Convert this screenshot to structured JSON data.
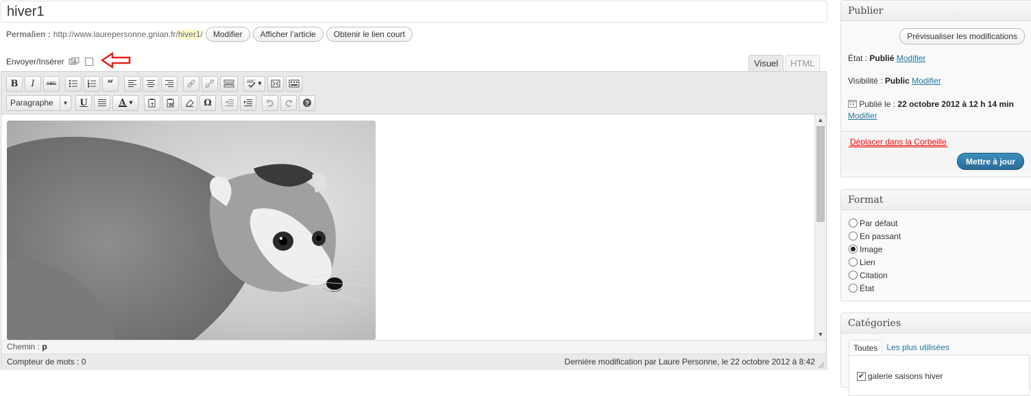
{
  "post": {
    "title": "hiver1",
    "permalink_label": "Permalien :",
    "permalink_base": "http://www.laurepersonne.gnian.fr/",
    "permalink_slug": "hiver1",
    "permalink_trailing": "/",
    "buttons": {
      "edit": "Modifier",
      "view": "Afficher l’article",
      "shortlink": "Obtenir le lien court"
    }
  },
  "media": {
    "label": "Envoyer/Insérer",
    "icon": "media-upload-icon"
  },
  "editor": {
    "tabs": [
      "Visuel",
      "HTML"
    ],
    "active_tab": "Visuel",
    "format_select": "Paragraphe",
    "image_alt": "lemur photograph (black and white)",
    "path_label": "Chemin :",
    "path_value": "p",
    "word_count": "Compteur de mots : 0",
    "last_modified": "Dernière modification par Laure Personne, le 22 octobre 2012 à 8:42",
    "toolbar_row1": [
      "bold",
      "italic",
      "strikethrough",
      "bullet-list",
      "numbered-list",
      "blockquote",
      "align-left",
      "align-center",
      "align-right",
      "link",
      "unlink",
      "more-tag",
      "spellcheck",
      "fullscreen",
      "kitchen-sink"
    ],
    "toolbar_row2": [
      "underline",
      "justify",
      "text-color",
      "paste-text",
      "paste-word",
      "clear-formatting",
      "special-character",
      "outdent",
      "indent",
      "undo",
      "redo",
      "help"
    ]
  },
  "publish": {
    "heading": "Publier",
    "preview_button": "Prévisualiser les modifications",
    "status_label": "État :",
    "status_value": "Publié",
    "visibility_label": "Visibilité :",
    "visibility_value": "Public",
    "edit_link": "Modifier",
    "published_label": "Publié le :",
    "published_value": "22 octobre 2012 à 12 h 14 min",
    "trash_link": "Déplacer dans la Corbeille",
    "update_button": "Mettre à jour"
  },
  "format": {
    "heading": "Format",
    "options": [
      "Par défaut",
      "En passant",
      "Image",
      "Lien",
      "Citation",
      "État"
    ],
    "selected": "Image"
  },
  "categories": {
    "heading": "Catégories",
    "tabs": [
      "Toutes",
      "Les plus utilisées"
    ],
    "items": [
      {
        "label": "galerie saisons hiver",
        "checked": true
      }
    ]
  },
  "colors": {
    "accent": "#21759b",
    "update_button": "#2a6d96",
    "trash": "#ff0000",
    "annotation_arrow": "#e02020"
  }
}
